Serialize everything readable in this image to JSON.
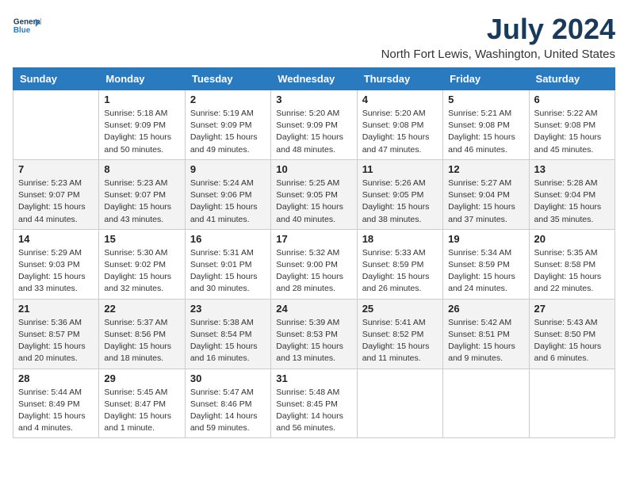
{
  "logo": {
    "line1": "General",
    "line2": "Blue"
  },
  "title": "July 2024",
  "location": "North Fort Lewis, Washington, United States",
  "days_of_week": [
    "Sunday",
    "Monday",
    "Tuesday",
    "Wednesday",
    "Thursday",
    "Friday",
    "Saturday"
  ],
  "weeks": [
    [
      {
        "day": "",
        "info": ""
      },
      {
        "day": "1",
        "info": "Sunrise: 5:18 AM\nSunset: 9:09 PM\nDaylight: 15 hours\nand 50 minutes."
      },
      {
        "day": "2",
        "info": "Sunrise: 5:19 AM\nSunset: 9:09 PM\nDaylight: 15 hours\nand 49 minutes."
      },
      {
        "day": "3",
        "info": "Sunrise: 5:20 AM\nSunset: 9:09 PM\nDaylight: 15 hours\nand 48 minutes."
      },
      {
        "day": "4",
        "info": "Sunrise: 5:20 AM\nSunset: 9:08 PM\nDaylight: 15 hours\nand 47 minutes."
      },
      {
        "day": "5",
        "info": "Sunrise: 5:21 AM\nSunset: 9:08 PM\nDaylight: 15 hours\nand 46 minutes."
      },
      {
        "day": "6",
        "info": "Sunrise: 5:22 AM\nSunset: 9:08 PM\nDaylight: 15 hours\nand 45 minutes."
      }
    ],
    [
      {
        "day": "7",
        "info": "Sunrise: 5:23 AM\nSunset: 9:07 PM\nDaylight: 15 hours\nand 44 minutes."
      },
      {
        "day": "8",
        "info": "Sunrise: 5:23 AM\nSunset: 9:07 PM\nDaylight: 15 hours\nand 43 minutes."
      },
      {
        "day": "9",
        "info": "Sunrise: 5:24 AM\nSunset: 9:06 PM\nDaylight: 15 hours\nand 41 minutes."
      },
      {
        "day": "10",
        "info": "Sunrise: 5:25 AM\nSunset: 9:05 PM\nDaylight: 15 hours\nand 40 minutes."
      },
      {
        "day": "11",
        "info": "Sunrise: 5:26 AM\nSunset: 9:05 PM\nDaylight: 15 hours\nand 38 minutes."
      },
      {
        "day": "12",
        "info": "Sunrise: 5:27 AM\nSunset: 9:04 PM\nDaylight: 15 hours\nand 37 minutes."
      },
      {
        "day": "13",
        "info": "Sunrise: 5:28 AM\nSunset: 9:04 PM\nDaylight: 15 hours\nand 35 minutes."
      }
    ],
    [
      {
        "day": "14",
        "info": "Sunrise: 5:29 AM\nSunset: 9:03 PM\nDaylight: 15 hours\nand 33 minutes."
      },
      {
        "day": "15",
        "info": "Sunrise: 5:30 AM\nSunset: 9:02 PM\nDaylight: 15 hours\nand 32 minutes."
      },
      {
        "day": "16",
        "info": "Sunrise: 5:31 AM\nSunset: 9:01 PM\nDaylight: 15 hours\nand 30 minutes."
      },
      {
        "day": "17",
        "info": "Sunrise: 5:32 AM\nSunset: 9:00 PM\nDaylight: 15 hours\nand 28 minutes."
      },
      {
        "day": "18",
        "info": "Sunrise: 5:33 AM\nSunset: 8:59 PM\nDaylight: 15 hours\nand 26 minutes."
      },
      {
        "day": "19",
        "info": "Sunrise: 5:34 AM\nSunset: 8:59 PM\nDaylight: 15 hours\nand 24 minutes."
      },
      {
        "day": "20",
        "info": "Sunrise: 5:35 AM\nSunset: 8:58 PM\nDaylight: 15 hours\nand 22 minutes."
      }
    ],
    [
      {
        "day": "21",
        "info": "Sunrise: 5:36 AM\nSunset: 8:57 PM\nDaylight: 15 hours\nand 20 minutes."
      },
      {
        "day": "22",
        "info": "Sunrise: 5:37 AM\nSunset: 8:56 PM\nDaylight: 15 hours\nand 18 minutes."
      },
      {
        "day": "23",
        "info": "Sunrise: 5:38 AM\nSunset: 8:54 PM\nDaylight: 15 hours\nand 16 minutes."
      },
      {
        "day": "24",
        "info": "Sunrise: 5:39 AM\nSunset: 8:53 PM\nDaylight: 15 hours\nand 13 minutes."
      },
      {
        "day": "25",
        "info": "Sunrise: 5:41 AM\nSunset: 8:52 PM\nDaylight: 15 hours\nand 11 minutes."
      },
      {
        "day": "26",
        "info": "Sunrise: 5:42 AM\nSunset: 8:51 PM\nDaylight: 15 hours\nand 9 minutes."
      },
      {
        "day": "27",
        "info": "Sunrise: 5:43 AM\nSunset: 8:50 PM\nDaylight: 15 hours\nand 6 minutes."
      }
    ],
    [
      {
        "day": "28",
        "info": "Sunrise: 5:44 AM\nSunset: 8:49 PM\nDaylight: 15 hours\nand 4 minutes."
      },
      {
        "day": "29",
        "info": "Sunrise: 5:45 AM\nSunset: 8:47 PM\nDaylight: 15 hours\nand 1 minute."
      },
      {
        "day": "30",
        "info": "Sunrise: 5:47 AM\nSunset: 8:46 PM\nDaylight: 14 hours\nand 59 minutes."
      },
      {
        "day": "31",
        "info": "Sunrise: 5:48 AM\nSunset: 8:45 PM\nDaylight: 14 hours\nand 56 minutes."
      },
      {
        "day": "",
        "info": ""
      },
      {
        "day": "",
        "info": ""
      },
      {
        "day": "",
        "info": ""
      }
    ]
  ]
}
